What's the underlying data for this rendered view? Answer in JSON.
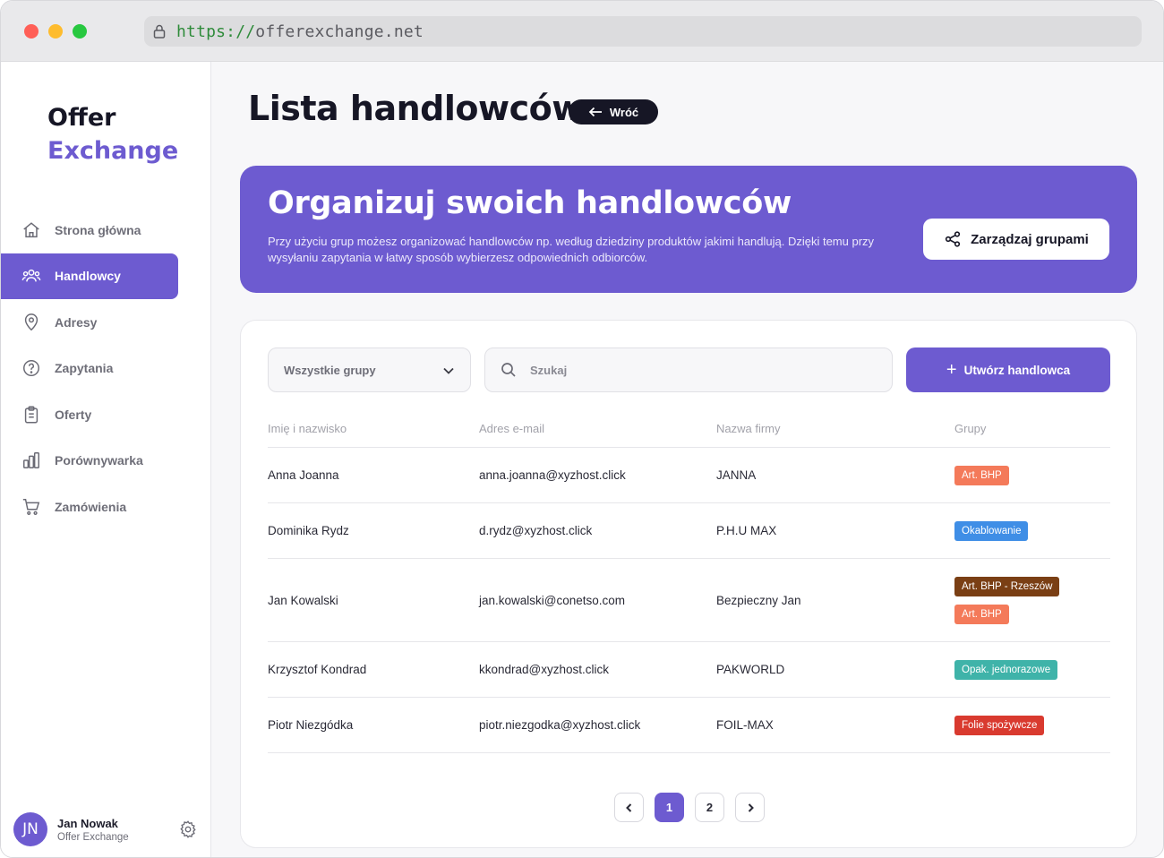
{
  "browser": {
    "url_scheme": "https://",
    "url_host": "offerexchange.net"
  },
  "logo": {
    "line1": "Offer",
    "line2": "Exchange"
  },
  "sidebar": {
    "items": [
      {
        "label": "Strona główna",
        "icon": "home-icon"
      },
      {
        "label": "Handlowcy",
        "icon": "users-icon",
        "active": true
      },
      {
        "label": "Adresy",
        "icon": "map-pin-icon"
      },
      {
        "label": "Zapytania",
        "icon": "question-icon"
      },
      {
        "label": "Oferty",
        "icon": "clipboard-icon"
      },
      {
        "label": "Porównywarka",
        "icon": "bar-chart-icon"
      },
      {
        "label": "Zamówienia",
        "icon": "cart-icon"
      }
    ]
  },
  "user": {
    "initials": "JN",
    "name": "Jan Nowak",
    "company": "Offer Exchange"
  },
  "page": {
    "title": "Lista handlowców",
    "back_label": "Wróć"
  },
  "banner": {
    "title": "Organizuj swoich handlowców",
    "text": "Przy użyciu grup możesz organizować handlowców np. według dziedziny produktów jakimi handlują. Dzięki temu przy wysyłaniu zapytania w łatwy sposób wybierzesz odpowiednich odbiorców.",
    "button_label": "Zarządzaj grupami"
  },
  "filters": {
    "group_select": "Wszystkie grupy",
    "search_placeholder": "Szukaj",
    "create_label": "Utwórz handlowca"
  },
  "table": {
    "headers": [
      "Imię i nazwisko",
      "Adres e-mail",
      "Nazwa firmy",
      "Grupy"
    ],
    "rows": [
      {
        "name": "Anna Joanna",
        "email": "anna.joanna@xyzhost.click",
        "company": "JANNA",
        "groups": [
          {
            "label": "Art. BHP",
            "color": "#f47a5a"
          }
        ]
      },
      {
        "name": "Dominika Rydz",
        "email": "d.rydz@xyzhost.click",
        "company": "P.H.U MAX",
        "groups": [
          {
            "label": "Okablowanie",
            "color": "#3f8ee6"
          }
        ]
      },
      {
        "name": "Jan Kowalski",
        "email": "jan.kowalski@conetso.com",
        "company": "Bezpieczny Jan",
        "groups": [
          {
            "label": "Art. BHP - Rzeszów",
            "color": "#7a3f14"
          },
          {
            "label": "Art. BHP",
            "color": "#f47a5a"
          }
        ]
      },
      {
        "name": "Krzysztof Kondrad",
        "email": "kkondrad@xyzhost.click",
        "company": "PAKWORLD",
        "groups": [
          {
            "label": "Opak. jednorazowe",
            "color": "#3fb3a9"
          }
        ]
      },
      {
        "name": "Piotr Niezgódka",
        "email": "piotr.niezgodka@xyzhost.click",
        "company": "FOIL-MAX",
        "groups": [
          {
            "label": "Folie spożywcze",
            "color": "#d93a2f"
          }
        ]
      }
    ]
  },
  "pagination": {
    "pages": [
      "1",
      "2"
    ],
    "current": "1"
  },
  "colors": {
    "accent": "#6d5bd0",
    "dark": "#161625"
  }
}
